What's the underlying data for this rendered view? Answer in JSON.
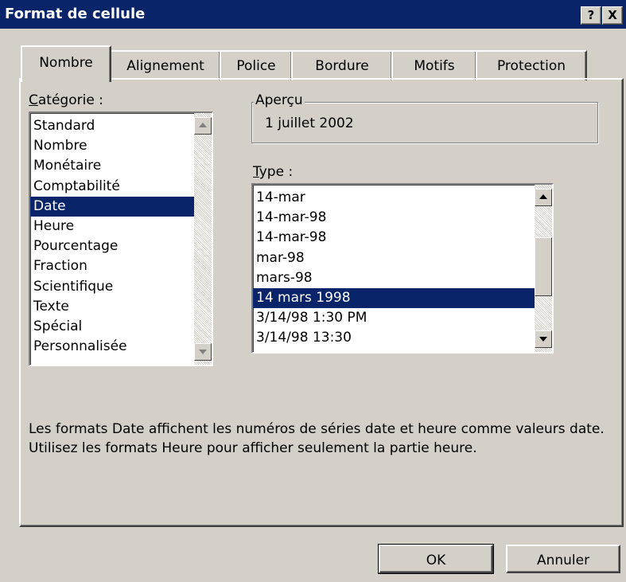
{
  "window": {
    "title": "Format de cellule",
    "help_label": "?",
    "close_label": "X"
  },
  "tabs": [
    {
      "label": "Nombre",
      "active": true
    },
    {
      "label": "Alignement",
      "active": false
    },
    {
      "label": "Police",
      "active": false
    },
    {
      "label": "Bordure",
      "active": false
    },
    {
      "label": "Motifs",
      "active": false
    },
    {
      "label": "Protection",
      "active": false
    }
  ],
  "category": {
    "label_underlined": "C",
    "label_rest": "atégorie :",
    "items": [
      "Standard",
      "Nombre",
      "Monétaire",
      "Comptabilité",
      "Date",
      "Heure",
      "Pourcentage",
      "Fraction",
      "Scientifique",
      "Texte",
      "Spécial",
      "Personnalisée"
    ],
    "selected": "Date"
  },
  "preview": {
    "legend": "Aperçu",
    "value": "1 juillet 2002"
  },
  "type": {
    "label_underlined": "T",
    "label_rest": "ype :",
    "items": [
      "14-mar",
      "14-mar-98",
      "14-mar-98",
      "mar-98",
      "mars-98",
      "14 mars 1998",
      "3/14/98 1:30 PM",
      "3/14/98 13:30"
    ],
    "selected": "14 mars 1998"
  },
  "description": "Les formats Date affichent les numéros de séries date et heure comme valeurs date. Utilisez les formats Heure pour afficher seulement la partie heure.",
  "buttons": {
    "ok": "OK",
    "cancel": "Annuler"
  },
  "colors": {
    "titlebar": "#0a246a",
    "selection": "#0a246a",
    "dialog_bg": "#d4d0c8"
  }
}
